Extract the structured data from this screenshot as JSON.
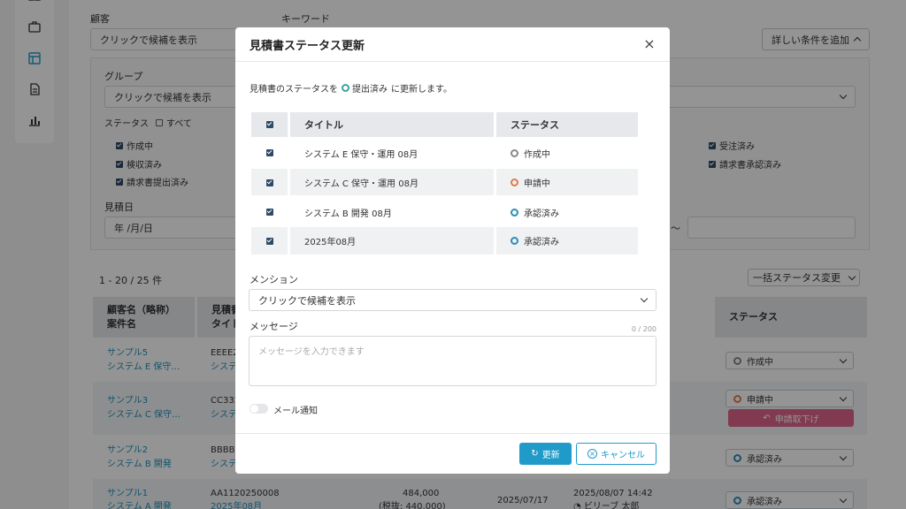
{
  "filters": {
    "customer_label": "顧客",
    "customer_placeholder": "クリックで候補を表示",
    "keyword_label": "キーワード",
    "advanced_button": "詳しい条件を追加",
    "group_label": "グループ",
    "group_placeholder": "クリックで候補を表示",
    "status_label": "ステータス",
    "status_all": "すべて",
    "status_options": [
      "作成中",
      "検収済み",
      "請求書提出済み",
      "受注済み",
      "請求書承認済み"
    ],
    "date_label": "見積日",
    "date_placeholder": "年 /月/日",
    "date_separator": "〜"
  },
  "list": {
    "count": "1 - 20 / 25 件",
    "bulk_button": "一括ステータス変更",
    "headers": {
      "customer": "顧客名（略称）",
      "project": "案件名",
      "number_partial": "見積書",
      "title_partial": "タイト",
      "status": "ステータス"
    },
    "rows": [
      {
        "customer": "サンプル5",
        "project": "システム E 保守…",
        "number": "EEEE2",
        "title": "システ",
        "status": "作成中",
        "status_color": "gray"
      },
      {
        "customer": "サンプル3",
        "project": "システム C 保守…",
        "number": "CC332",
        "title": "システ",
        "status": "申請中",
        "status_color": "orange",
        "action": "申請取下げ"
      },
      {
        "customer": "サンプル2",
        "project": "システム B 開発",
        "number": "BBBB2",
        "title": "システ",
        "status": "承認済み",
        "status_color": "blue"
      },
      {
        "customer": "サンプル1",
        "project": "システム A 開発",
        "number": "AA1120250008",
        "title": "2025年08月",
        "amount": "484,000",
        "amount_tax": "(税抜: 440,000)",
        "date": "2025/07/17",
        "updated": "2025/08/07 14:42",
        "user": "ビリーブ 太郎",
        "status": "承認済み",
        "status_color": "blue"
      }
    ]
  },
  "modal": {
    "title": "見積書ステータス更新",
    "message_prefix": "見積書のステータスを",
    "message_status": "提出済み",
    "message_suffix": "に更新します。",
    "col_title": "タイトル",
    "col_status": "ステータス",
    "rows": [
      {
        "title": "システム E 保守・運用 08月",
        "status": "作成中",
        "color": "gray"
      },
      {
        "title": "システム C 保守・運用 08月",
        "status": "申請中",
        "color": "orange"
      },
      {
        "title": "システム B 開発 08月",
        "status": "承認済み",
        "color": "blue"
      },
      {
        "title": "2025年08月",
        "status": "承認済み",
        "color": "blue"
      }
    ],
    "mention_label": "メンション",
    "mention_placeholder": "クリックで候補を表示",
    "message_label": "メッセージ",
    "message_counter": "0 / 200",
    "message_placeholder": "メッセージを入力できます",
    "mail_toggle_label": "メール通知",
    "update_button": "更新",
    "cancel_button": "キャンセル"
  },
  "colors": {
    "accent": "#1f9ac9",
    "gray": "#888888",
    "orange": "#e07a4c",
    "blue": "#2e8cb8",
    "pink": "#e0648b"
  }
}
